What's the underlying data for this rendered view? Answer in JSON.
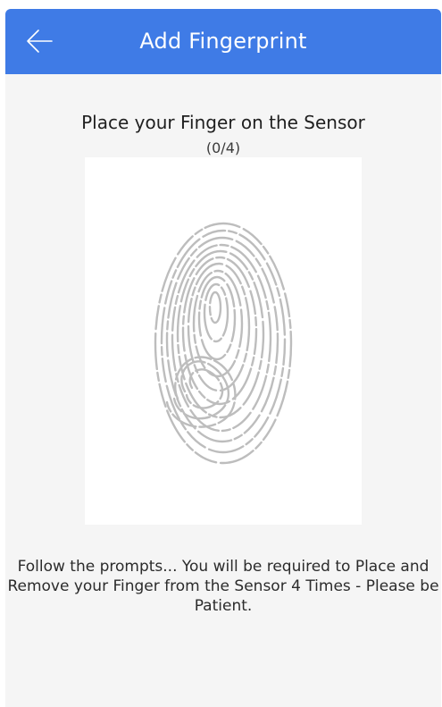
{
  "header": {
    "title": "Add Fingerprint",
    "back_icon": "arrow-left-icon",
    "background_color": "#3f7be6"
  },
  "main": {
    "instruction": "Place your Finger on the Sensor",
    "progress": "(0/4)",
    "fingerprint_icon": "fingerprint-icon",
    "help_text": "Follow the prompts... You will be required to Place and Remove your Finger from the Sensor 4 Times - Please be Patient."
  }
}
